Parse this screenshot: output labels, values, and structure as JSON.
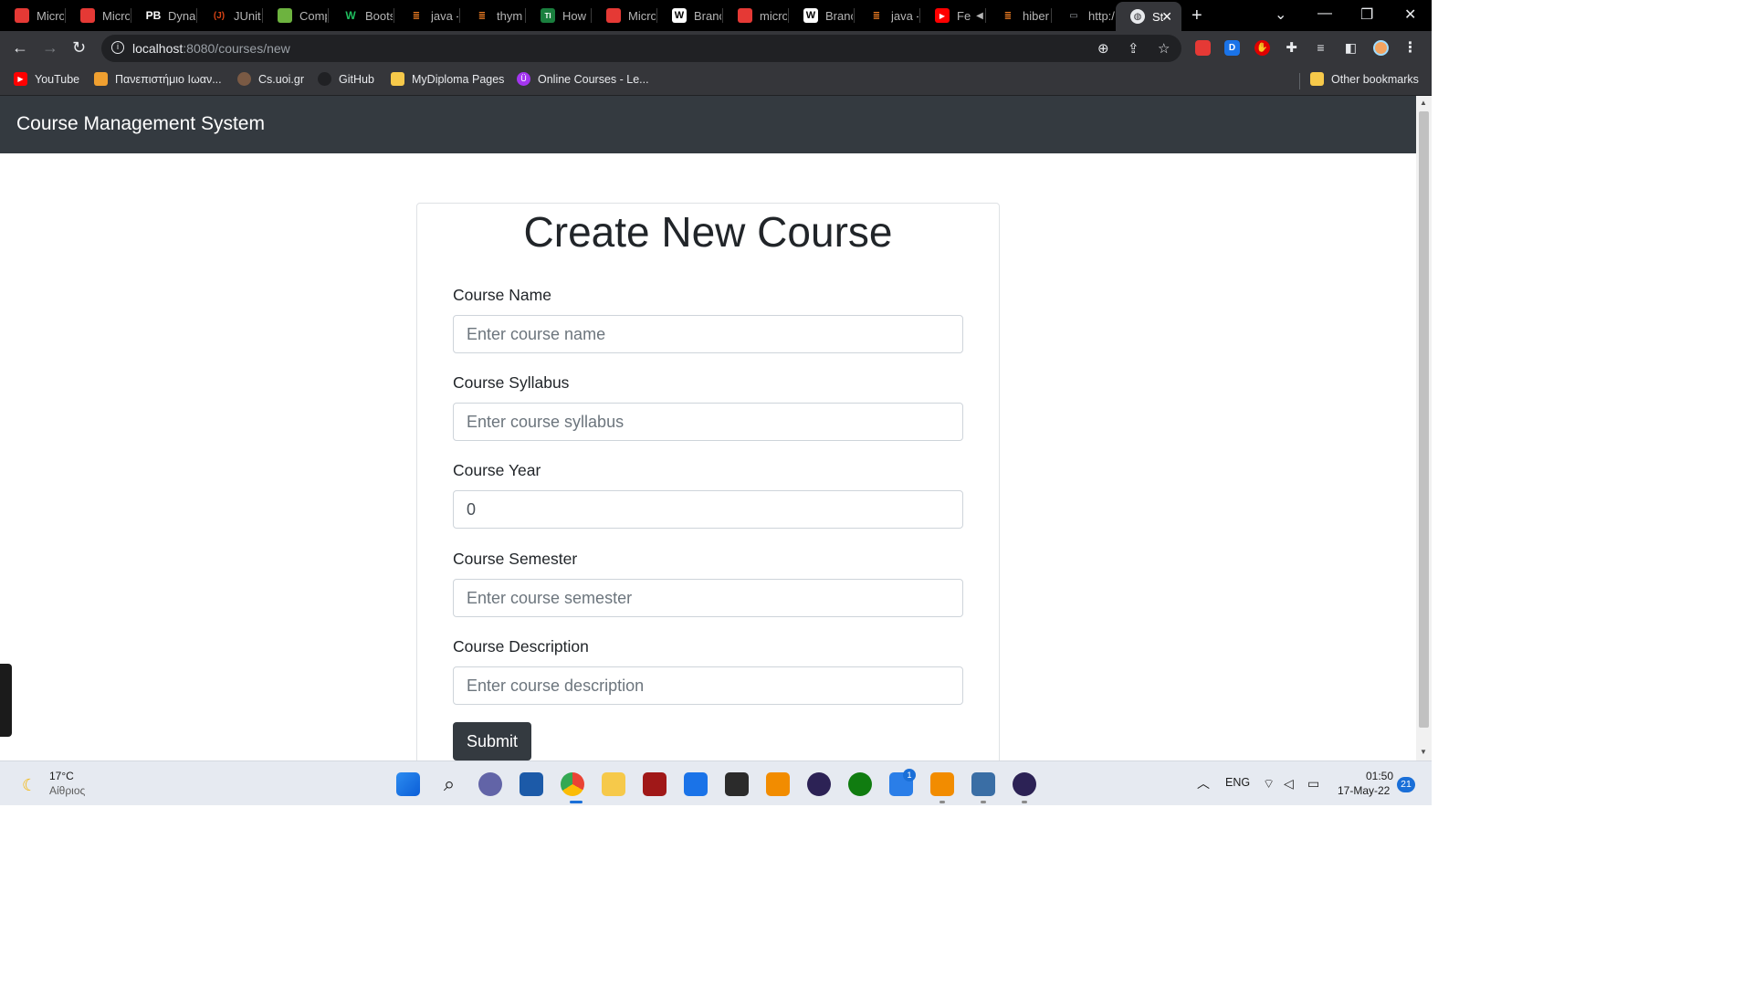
{
  "browser": {
    "tabs": [
      {
        "title": "Micro",
        "icon": "pdf-icon",
        "color": "#e53935"
      },
      {
        "title": "Micro",
        "icon": "pdf-icon",
        "color": "#e53935"
      },
      {
        "title": "Dynai",
        "icon": "pb-icon",
        "color": "#000000"
      },
      {
        "title": "JUnit",
        "icon": "junit-icon",
        "color": "#d84315"
      },
      {
        "title": "Comp",
        "icon": "spring-icon",
        "color": "#6db33f"
      },
      {
        "title": "Boots",
        "icon": "w-icon",
        "color": "#1a8f3c"
      },
      {
        "title": "java -",
        "icon": "stackoverflow-icon",
        "color": "#f48024"
      },
      {
        "title": "thym",
        "icon": "stackoverflow-icon",
        "color": "#f48024"
      },
      {
        "title": "How",
        "icon": "ti-icon",
        "color": "#1a7f3e"
      },
      {
        "title": "Micro",
        "icon": "pdf-icon",
        "color": "#e53935"
      },
      {
        "title": "Branc",
        "icon": "wikipedia-icon",
        "color": "#ffffff"
      },
      {
        "title": "micro",
        "icon": "pdf-icon",
        "color": "#e53935"
      },
      {
        "title": "Branc",
        "icon": "wikipedia-icon",
        "color": "#ffffff"
      },
      {
        "title": "java -",
        "icon": "stackoverflow-icon",
        "color": "#f48024"
      },
      {
        "title": "Fe",
        "icon": "youtube-icon",
        "color": "#ff0000"
      },
      {
        "title": "hiber",
        "icon": "stackoverflow-icon",
        "color": "#f48024"
      },
      {
        "title": "http:/",
        "icon": "laptop-icon",
        "color": "#9aa0a6"
      }
    ],
    "active_tab": {
      "title": "St",
      "icon": "globe-icon"
    },
    "url_host": "localhost",
    "url_path": ":8080/courses/new",
    "bookmarks": [
      {
        "label": "YouTube",
        "icon": "youtube-icon",
        "color": "#ff0000"
      },
      {
        "label": "Πανεπιστήμιο Ιωαν...",
        "icon": "uoi-icon",
        "color": "#f0a030"
      },
      {
        "label": "Cs.uoi.gr",
        "icon": "csuoi-icon",
        "color": "#7a5a44"
      },
      {
        "label": "GitHub",
        "icon": "github-icon",
        "color": "#202124"
      },
      {
        "label": "MyDiploma Pages",
        "icon": "folder-icon",
        "color": "#f6c94a"
      },
      {
        "label": "Online Courses - Le...",
        "icon": "udemy-icon",
        "color": "#a435f0"
      }
    ],
    "other_bookmarks": "Other bookmarks"
  },
  "page": {
    "brand": "Course Management System",
    "heading": "Create New Course",
    "fields": [
      {
        "label": "Course Name",
        "placeholder": "Enter course name",
        "value": ""
      },
      {
        "label": "Course Syllabus",
        "placeholder": "Enter course syllabus",
        "value": ""
      },
      {
        "label": "Course Year",
        "placeholder": "",
        "value": "0"
      },
      {
        "label": "Course Semester",
        "placeholder": "Enter course semester",
        "value": ""
      },
      {
        "label": "Course Description",
        "placeholder": "Enter course description",
        "value": ""
      }
    ],
    "submit_label": "Submit"
  },
  "overlay": {
    "screenrec": "screenrec"
  },
  "taskbar": {
    "weather_temp": "17°C",
    "weather_desc": "Αίθριος",
    "language": "ENG",
    "time": "01:50",
    "date": "17-May-22",
    "notifications": "21",
    "todo_badge": "1"
  }
}
